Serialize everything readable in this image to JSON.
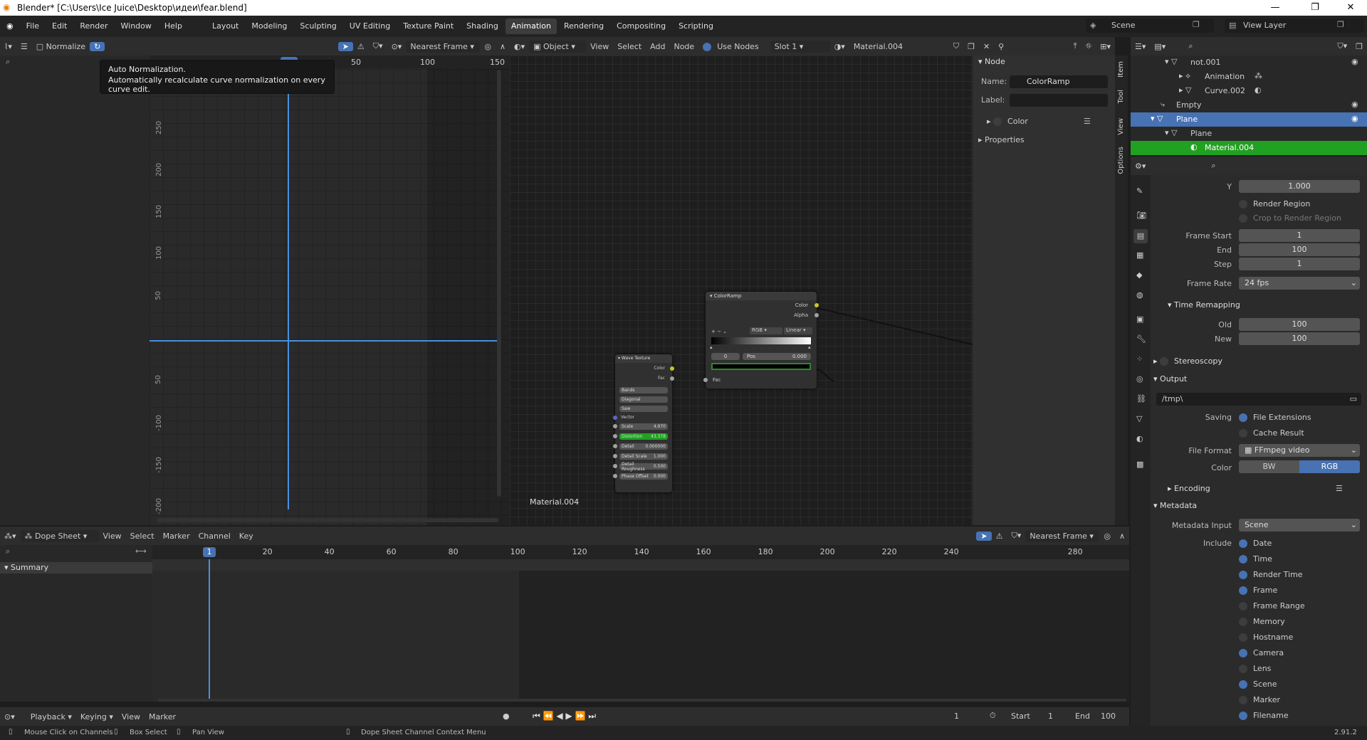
{
  "title": "Blender* [C:\\Users\\Ice Juice\\Desktop\\идеи\\fear.blend]",
  "menu": [
    "File",
    "Edit",
    "Render",
    "Window",
    "Help"
  ],
  "workspaces": [
    "Layout",
    "Modeling",
    "Sculpting",
    "UV Editing",
    "Texture Paint",
    "Shading",
    "Animation",
    "Rendering",
    "Compositing",
    "Scripting"
  ],
  "active_workspace": "Animation",
  "scene": "Scene",
  "view_layer": "View Layer",
  "graph": {
    "normalize": "Normalize",
    "snap": "Nearest Frame",
    "frame_ticks": [
      "50",
      "100",
      "150"
    ],
    "value_ticks": [
      "250",
      "200",
      "150",
      "100",
      "50",
      "50",
      "-100",
      "-150",
      "-200"
    ],
    "tooltip_title": "Auto Normalization.",
    "tooltip_body": "Automatically recalculate curve normalization on every curve edit."
  },
  "node_editor": {
    "mode": "Object",
    "menus": [
      "View",
      "Select",
      "Add",
      "Node"
    ],
    "use_nodes": "Use Nodes",
    "slot": "Slot 1",
    "material": "Material.004",
    "material_label": "Material.004",
    "colorramp": {
      "title": "ColorRamp",
      "out_color": "Color",
      "out_alpha": "Alpha",
      "mode": "RGB",
      "interp": "Linear",
      "index": "0",
      "pos_label": "Pos",
      "pos": "0.000",
      "in_fac": "Fac"
    },
    "wave": {
      "title": "Wave Texture",
      "out_color": "Color",
      "out_fac": "Fac",
      "type": "Bands",
      "dir": "Diagonal",
      "profile": "Saw",
      "vector": "Vector",
      "fields": [
        {
          "label": "Scale",
          "value": "4.970"
        },
        {
          "label": "Distortion",
          "value": "43.378"
        },
        {
          "label": "Detail",
          "value": "0.000000"
        },
        {
          "label": "Detail Scale",
          "value": "1.000"
        },
        {
          "label": "Detail Roughness",
          "value": "0.500"
        },
        {
          "label": "Phase Offset",
          "value": "0.000"
        }
      ]
    }
  },
  "npanel": {
    "node": "Node",
    "name_label": "Name:",
    "name": "ColorRamp",
    "label_label": "Label:",
    "color": "Color",
    "properties": "Properties",
    "tabs": [
      "Item",
      "Tool",
      "View",
      "Options"
    ]
  },
  "outliner": [
    {
      "label": "not.001",
      "depth": 2
    },
    {
      "label": "Animation",
      "depth": 3
    },
    {
      "label": "Curve.002",
      "depth": 3
    },
    {
      "label": "Empty",
      "depth": 1
    },
    {
      "label": "Plane",
      "depth": 1
    },
    {
      "label": "Plane",
      "depth": 2
    },
    {
      "label": "Material.004",
      "depth": 3
    }
  ],
  "props": {
    "y_label": "Y",
    "y": "1.000",
    "render_region": "Render Region",
    "crop": "Crop to Render Region",
    "frame_start_label": "Frame Start",
    "frame_start": "1",
    "end_label": "End",
    "end": "100",
    "step_label": "Step",
    "step": "1",
    "fps_label": "Frame Rate",
    "fps": "24 fps",
    "time_remap": "Time Remapping",
    "old_label": "Old",
    "old": "100",
    "new_label": "New",
    "new": "100",
    "stereo": "Stereoscopy",
    "output": "Output",
    "path": "/tmp\\",
    "saving": "Saving",
    "file_ext": "File Extensions",
    "cache": "Cache Result",
    "format_label": "File Format",
    "format": "FFmpeg video",
    "color_label": "Color",
    "bw": "BW",
    "rgb": "RGB",
    "encoding": "Encoding",
    "metadata": "Metadata",
    "meta_input_label": "Metadata Input",
    "meta_input": "Scene",
    "include": "Include",
    "meta_items": [
      {
        "label": "Date",
        "on": true
      },
      {
        "label": "Time",
        "on": true
      },
      {
        "label": "Render Time",
        "on": true
      },
      {
        "label": "Frame",
        "on": true
      },
      {
        "label": "Frame Range",
        "on": false
      },
      {
        "label": "Memory",
        "on": false
      },
      {
        "label": "Hostname",
        "on": false
      },
      {
        "label": "Camera",
        "on": true
      },
      {
        "label": "Lens",
        "on": false
      },
      {
        "label": "Scene",
        "on": true
      },
      {
        "label": "Marker",
        "on": false
      },
      {
        "label": "Filename",
        "on": true
      }
    ]
  },
  "dope": {
    "mode": "Dope Sheet",
    "menus": [
      "View",
      "Select",
      "Marker",
      "Channel",
      "Key"
    ],
    "snap": "Nearest Frame",
    "current": "1",
    "ticks": [
      "20",
      "40",
      "60",
      "80",
      "100",
      "120",
      "140",
      "160",
      "180",
      "200",
      "220",
      "240",
      "280"
    ],
    "summary": "Summary"
  },
  "timeline": {
    "menus": [
      "Playback",
      "Keying",
      "View",
      "Marker"
    ],
    "frame": "1",
    "start_label": "Start",
    "start": "1",
    "end_label": "End",
    "end": "100"
  },
  "status": {
    "mouse": "Mouse Click on Channels",
    "box": "Box Select",
    "pan": "Pan View",
    "ctx": "Dope Sheet Channel Context Menu",
    "version": "2.91.2"
  }
}
